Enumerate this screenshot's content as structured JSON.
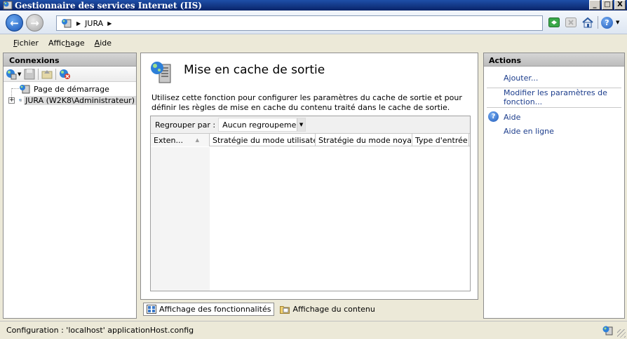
{
  "window": {
    "title": "Gestionnaire des services Internet (IIS)",
    "minimize": "_",
    "maximize": "□",
    "close": "X"
  },
  "address": {
    "crumbs": [
      "JURA"
    ]
  },
  "menu": {
    "items": [
      {
        "label": "Fichier",
        "mnemonic": "F"
      },
      {
        "label": "Affichage",
        "mnemonic": "h"
      },
      {
        "label": "Aide",
        "mnemonic": "A"
      }
    ]
  },
  "connections": {
    "title": "Connexions",
    "tree": [
      {
        "label": "Page de démarrage",
        "expander": ""
      },
      {
        "label": "JURA (W2K8\\Administrateur)",
        "expander": "+"
      }
    ]
  },
  "feature": {
    "title": "Mise en cache de sortie",
    "description": "Utilisez cette fonction pour configurer les paramètres du cache de sortie et pour définir les règles de mise en cache du contenu traité dans le cache de sortie.",
    "group_label": "Regrouper par :",
    "group_value": "Aucun regroupement",
    "columns": [
      "Exten...",
      "Stratégie du mode utilisateur",
      "Stratégie du mode noyau",
      "Type d'entrée"
    ]
  },
  "views": {
    "features": "Affichage des fonctionnalités",
    "content": "Affichage du contenu"
  },
  "actions": {
    "title": "Actions",
    "add": "Ajouter...",
    "modify": "Modifier les paramètres de fonction...",
    "help": "Aide",
    "online_help": "Aide en ligne"
  },
  "status": {
    "text": "Configuration : 'localhost' applicationHost.config"
  },
  "colors": {
    "link": "#1c3d8c",
    "titlebar": "#0a246a"
  }
}
